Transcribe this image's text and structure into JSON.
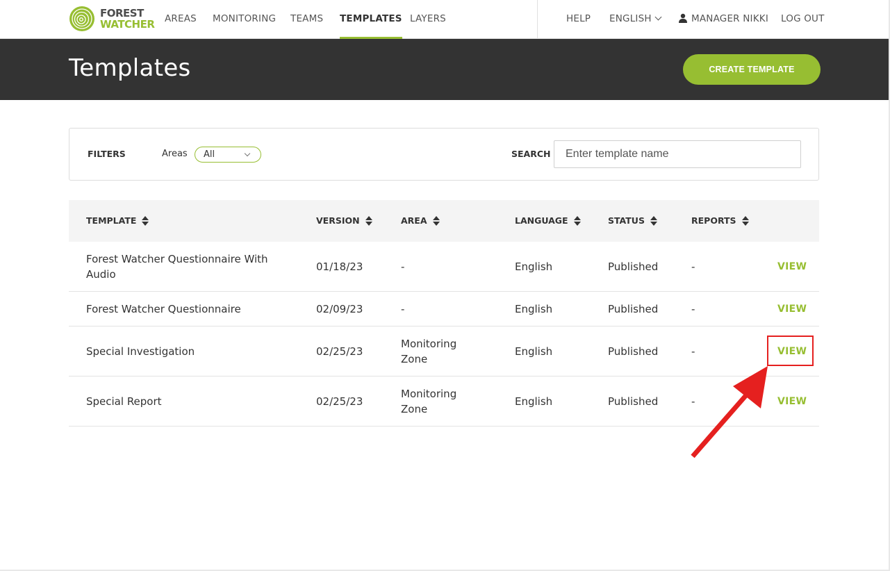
{
  "brand": {
    "line1": "FOREST",
    "line2": "WATCHER",
    "accent_color": "#97be32",
    "dark_color": "#333333"
  },
  "nav": {
    "items": [
      {
        "label": "AREAS",
        "active": false
      },
      {
        "label": "MONITORING",
        "active": false
      },
      {
        "label": "TEAMS",
        "active": false
      },
      {
        "label": "TEMPLATES",
        "active": true
      },
      {
        "label": "LAYERS",
        "active": false
      }
    ],
    "help": "HELP",
    "language": "ENGLISH",
    "user": "MANAGER NIKKI",
    "logout": "LOG OUT"
  },
  "header": {
    "title": "Templates",
    "create_button": "CREATE TEMPLATE"
  },
  "filters": {
    "label": "FILTERS",
    "areas_label": "Areas",
    "areas_value": "All",
    "search_label": "SEARCH",
    "search_placeholder": "Enter template name",
    "search_value": ""
  },
  "table": {
    "columns": [
      "TEMPLATE",
      "VERSION",
      "AREA",
      "LANGUAGE",
      "STATUS",
      "REPORTS"
    ],
    "view_label": "VIEW",
    "rows": [
      {
        "template": "Forest Watcher Questionnaire With Audio",
        "version": "01/18/23",
        "area": "-",
        "language": "English",
        "status": "Published",
        "reports": "-",
        "view": "VIEW"
      },
      {
        "template": "Forest Watcher Questionnaire",
        "version": "02/09/23",
        "area": "-",
        "language": "English",
        "status": "Published",
        "reports": "-",
        "view": "VIEW"
      },
      {
        "template": "Special Investigation",
        "version": "02/25/23",
        "area": "Monitoring Zone",
        "language": "English",
        "status": "Published",
        "reports": "-",
        "view": "VIEW"
      },
      {
        "template": "Special Report",
        "version": "02/25/23",
        "area": "Monitoring Zone",
        "language": "English",
        "status": "Published",
        "reports": "-",
        "view": "VIEW"
      }
    ]
  },
  "annotation": {
    "color": "#e5201f",
    "highlighted_row": 2
  }
}
